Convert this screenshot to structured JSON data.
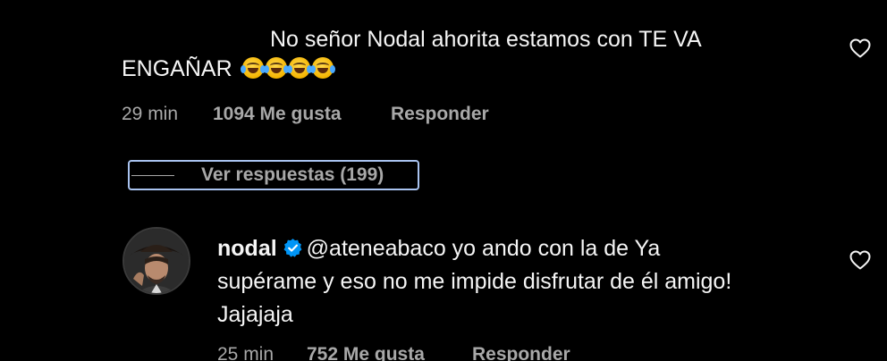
{
  "comment1": {
    "text_line1": "No señor Nodal ahorita estamos con TE VA",
    "text_line2": "ENGAÑAR",
    "emoji": "laughing-tears-emoji",
    "emoji_count": 4,
    "time": "29 min",
    "likes": "1094 Me gusta",
    "reply": "Responder",
    "like_icon": "heart-outline-icon"
  },
  "view_replies": {
    "label": "Ver respuestas (199)"
  },
  "comment2": {
    "username": "nodal",
    "verified_icon": "verified-badge-icon",
    "mention": "@ateneabaco",
    "text_after_mention": " yo ando con la de Ya",
    "text_line2": "supérame y eso no me impide disfrutar de él amigo!",
    "text_line3": "Jajajaja",
    "time": "25 min",
    "likes": "752 Me gusta",
    "reply": "Responder",
    "like_icon": "heart-outline-icon"
  },
  "colors": {
    "background": "#000000",
    "text": "#f5f5f5",
    "secondary_text": "#a8a8a8",
    "verified_blue": "#0095f6",
    "focus_ring": "#a9c3f0"
  }
}
